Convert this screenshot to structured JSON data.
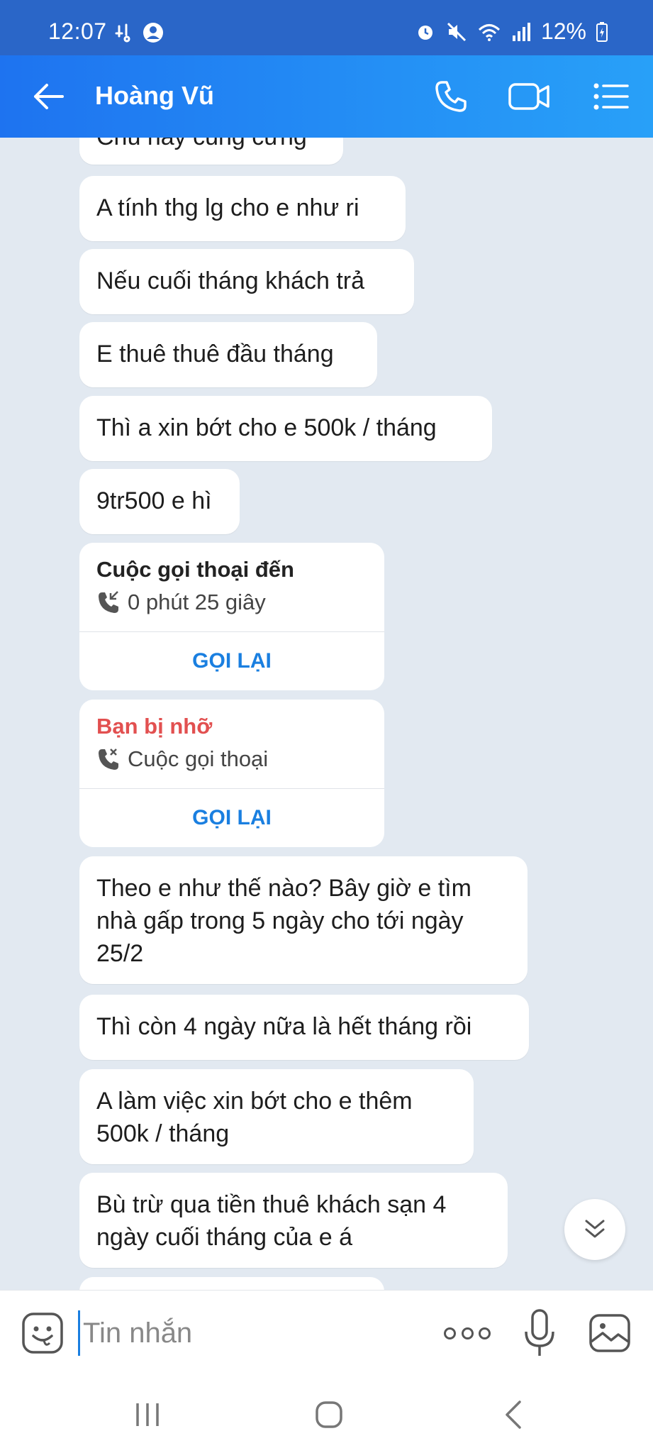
{
  "status_bar": {
    "time": "12:07",
    "battery": "12%"
  },
  "header": {
    "contact_name": "Hoàng Vũ",
    "icons": [
      "back-arrow-icon",
      "phone-icon",
      "video-camera-icon",
      "list-menu-icon"
    ]
  },
  "messages": [
    {
      "text": "Chú hay cũng cứng"
    },
    {
      "text": "A tính thg lg cho e như ri"
    },
    {
      "text": "Nếu cuối tháng khách trả"
    },
    {
      "text": "E thuê thuê đầu tháng"
    },
    {
      "text": "Thì a xin bớt cho e 500k / tháng"
    },
    {
      "text": "9tr500 e hì"
    },
    {
      "text": "Theo e như thế nào? Bây giờ e tìm nhà gấp trong 5 ngày cho tới ngày 25/2"
    },
    {
      "text": "Thì còn 4 ngày nữa là hết tháng rồi"
    },
    {
      "text": "A làm việc xin bớt cho e thêm 500k / tháng"
    },
    {
      "text": "Bù trừ qua tiền thuê khách sạn 4 ngày cuối tháng của e á"
    }
  ],
  "calls": [
    {
      "title": "Cuộc gọi thoại đến",
      "detail": "0 phút 25 giây",
      "action": "GỌI LẠI"
    },
    {
      "title": "Bạn bị nhỡ",
      "detail": "Cuộc gọi thoại",
      "action": "GỌI LẠI"
    }
  ],
  "composer": {
    "placeholder": "Tin nhắn"
  },
  "colors": {
    "header_start": "#1e73f0",
    "header_end": "#28a0f8",
    "chat_bg": "#e2e9f1",
    "accent": "#1a7fe0",
    "missed": "#e25050"
  }
}
